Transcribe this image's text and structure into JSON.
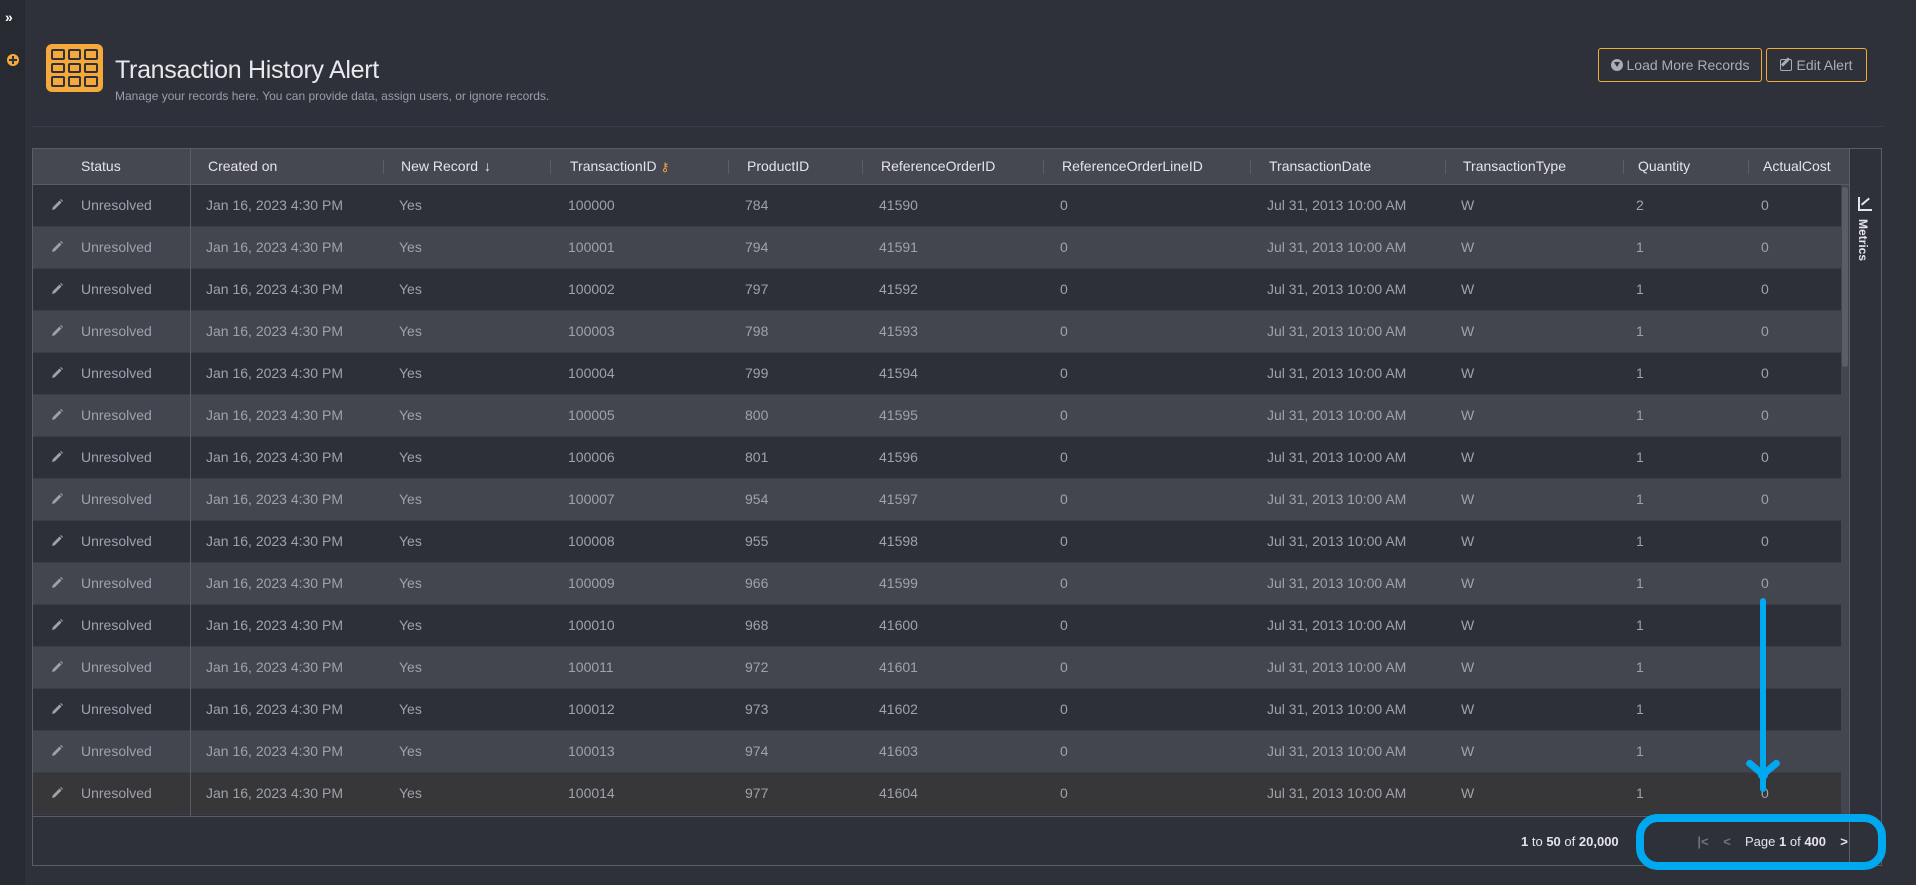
{
  "page": {
    "title": "Transaction History Alert",
    "subtitle": "Manage your records here. You can provide data, assign users, or ignore records."
  },
  "rail": {
    "expand_icon": "double-chevron-right-icon",
    "add_icon": "plus-circle-icon"
  },
  "toolbar": {
    "load_more_label": "Load More Records",
    "edit_alert_label": "Edit Alert"
  },
  "grid": {
    "columns": [
      {
        "key": "status",
        "label": "Status"
      },
      {
        "key": "created_on",
        "label": "Created on"
      },
      {
        "key": "new_record",
        "label": "New Record",
        "sort": "descending"
      },
      {
        "key": "transaction_id",
        "label": "TransactionID",
        "primary_key": true
      },
      {
        "key": "product_id",
        "label": "ProductID"
      },
      {
        "key": "reference_order_id",
        "label": "ReferenceOrderID"
      },
      {
        "key": "reference_order_line_id",
        "label": "ReferenceOrderLineID"
      },
      {
        "key": "transaction_date",
        "label": "TransactionDate"
      },
      {
        "key": "transaction_type",
        "label": "TransactionType"
      },
      {
        "key": "quantity",
        "label": "Quantity"
      },
      {
        "key": "actual_cost",
        "label": "ActualCost"
      }
    ],
    "rows": [
      {
        "status": "Unresolved",
        "created_on": "Jan 16, 2023 4:30 PM",
        "new_record": "Yes",
        "transaction_id": "100000",
        "product_id": "784",
        "reference_order_id": "41590",
        "reference_order_line_id": "0",
        "transaction_date": "Jul 31, 2013 10:00 AM",
        "transaction_type": "W",
        "quantity": "2",
        "actual_cost": "0"
      },
      {
        "status": "Unresolved",
        "created_on": "Jan 16, 2023 4:30 PM",
        "new_record": "Yes",
        "transaction_id": "100001",
        "product_id": "794",
        "reference_order_id": "41591",
        "reference_order_line_id": "0",
        "transaction_date": "Jul 31, 2013 10:00 AM",
        "transaction_type": "W",
        "quantity": "1",
        "actual_cost": "0"
      },
      {
        "status": "Unresolved",
        "created_on": "Jan 16, 2023 4:30 PM",
        "new_record": "Yes",
        "transaction_id": "100002",
        "product_id": "797",
        "reference_order_id": "41592",
        "reference_order_line_id": "0",
        "transaction_date": "Jul 31, 2013 10:00 AM",
        "transaction_type": "W",
        "quantity": "1",
        "actual_cost": "0"
      },
      {
        "status": "Unresolved",
        "created_on": "Jan 16, 2023 4:30 PM",
        "new_record": "Yes",
        "transaction_id": "100003",
        "product_id": "798",
        "reference_order_id": "41593",
        "reference_order_line_id": "0",
        "transaction_date": "Jul 31, 2013 10:00 AM",
        "transaction_type": "W",
        "quantity": "1",
        "actual_cost": "0"
      },
      {
        "status": "Unresolved",
        "created_on": "Jan 16, 2023 4:30 PM",
        "new_record": "Yes",
        "transaction_id": "100004",
        "product_id": "799",
        "reference_order_id": "41594",
        "reference_order_line_id": "0",
        "transaction_date": "Jul 31, 2013 10:00 AM",
        "transaction_type": "W",
        "quantity": "1",
        "actual_cost": "0"
      },
      {
        "status": "Unresolved",
        "created_on": "Jan 16, 2023 4:30 PM",
        "new_record": "Yes",
        "transaction_id": "100005",
        "product_id": "800",
        "reference_order_id": "41595",
        "reference_order_line_id": "0",
        "transaction_date": "Jul 31, 2013 10:00 AM",
        "transaction_type": "W",
        "quantity": "1",
        "actual_cost": "0"
      },
      {
        "status": "Unresolved",
        "created_on": "Jan 16, 2023 4:30 PM",
        "new_record": "Yes",
        "transaction_id": "100006",
        "product_id": "801",
        "reference_order_id": "41596",
        "reference_order_line_id": "0",
        "transaction_date": "Jul 31, 2013 10:00 AM",
        "transaction_type": "W",
        "quantity": "1",
        "actual_cost": "0"
      },
      {
        "status": "Unresolved",
        "created_on": "Jan 16, 2023 4:30 PM",
        "new_record": "Yes",
        "transaction_id": "100007",
        "product_id": "954",
        "reference_order_id": "41597",
        "reference_order_line_id": "0",
        "transaction_date": "Jul 31, 2013 10:00 AM",
        "transaction_type": "W",
        "quantity": "1",
        "actual_cost": "0"
      },
      {
        "status": "Unresolved",
        "created_on": "Jan 16, 2023 4:30 PM",
        "new_record": "Yes",
        "transaction_id": "100008",
        "product_id": "955",
        "reference_order_id": "41598",
        "reference_order_line_id": "0",
        "transaction_date": "Jul 31, 2013 10:00 AM",
        "transaction_type": "W",
        "quantity": "1",
        "actual_cost": "0"
      },
      {
        "status": "Unresolved",
        "created_on": "Jan 16, 2023 4:30 PM",
        "new_record": "Yes",
        "transaction_id": "100009",
        "product_id": "966",
        "reference_order_id": "41599",
        "reference_order_line_id": "0",
        "transaction_date": "Jul 31, 2013 10:00 AM",
        "transaction_type": "W",
        "quantity": "1",
        "actual_cost": "0"
      },
      {
        "status": "Unresolved",
        "created_on": "Jan 16, 2023 4:30 PM",
        "new_record": "Yes",
        "transaction_id": "100010",
        "product_id": "968",
        "reference_order_id": "41600",
        "reference_order_line_id": "0",
        "transaction_date": "Jul 31, 2013 10:00 AM",
        "transaction_type": "W",
        "quantity": "1",
        "actual_cost": ""
      },
      {
        "status": "Unresolved",
        "created_on": "Jan 16, 2023 4:30 PM",
        "new_record": "Yes",
        "transaction_id": "100011",
        "product_id": "972",
        "reference_order_id": "41601",
        "reference_order_line_id": "0",
        "transaction_date": "Jul 31, 2013 10:00 AM",
        "transaction_type": "W",
        "quantity": "1",
        "actual_cost": ""
      },
      {
        "status": "Unresolved",
        "created_on": "Jan 16, 2023 4:30 PM",
        "new_record": "Yes",
        "transaction_id": "100012",
        "product_id": "973",
        "reference_order_id": "41602",
        "reference_order_line_id": "0",
        "transaction_date": "Jul 31, 2013 10:00 AM",
        "transaction_type": "W",
        "quantity": "1",
        "actual_cost": ""
      },
      {
        "status": "Unresolved",
        "created_on": "Jan 16, 2023 4:30 PM",
        "new_record": "Yes",
        "transaction_id": "100013",
        "product_id": "974",
        "reference_order_id": "41603",
        "reference_order_line_id": "0",
        "transaction_date": "Jul 31, 2013 10:00 AM",
        "transaction_type": "W",
        "quantity": "1",
        "actual_cost": ""
      },
      {
        "status": "Unresolved",
        "created_on": "Jan 16, 2023 4:30 PM",
        "new_record": "Yes",
        "transaction_id": "100014",
        "product_id": "977",
        "reference_order_id": "41604",
        "reference_order_line_id": "0",
        "transaction_date": "Jul 31, 2013 10:00 AM",
        "transaction_type": "W",
        "quantity": "1",
        "actual_cost": "0"
      }
    ]
  },
  "side_panel": {
    "metrics_label": "Metrics",
    "metrics_icon": "line-chart-icon"
  },
  "footer": {
    "range_start": "1",
    "range_to": "to",
    "range_end": "50",
    "range_of": "of",
    "total": "20,000",
    "page_word": "Page",
    "current_page": "1",
    "page_of": "of",
    "total_pages": "400",
    "first_icon": "first-page-icon",
    "prev_icon": "previous-page-icon",
    "next_icon": "next-page-icon",
    "last_icon": "last-page-icon"
  },
  "annotation": {
    "color": "#00a8f0",
    "target": "pagination-controls"
  },
  "colors": {
    "accent": "#f6a93b",
    "background": "#2f313a",
    "header_row": "#454751",
    "row_odd": "#2e3039",
    "row_even": "#43464f"
  }
}
